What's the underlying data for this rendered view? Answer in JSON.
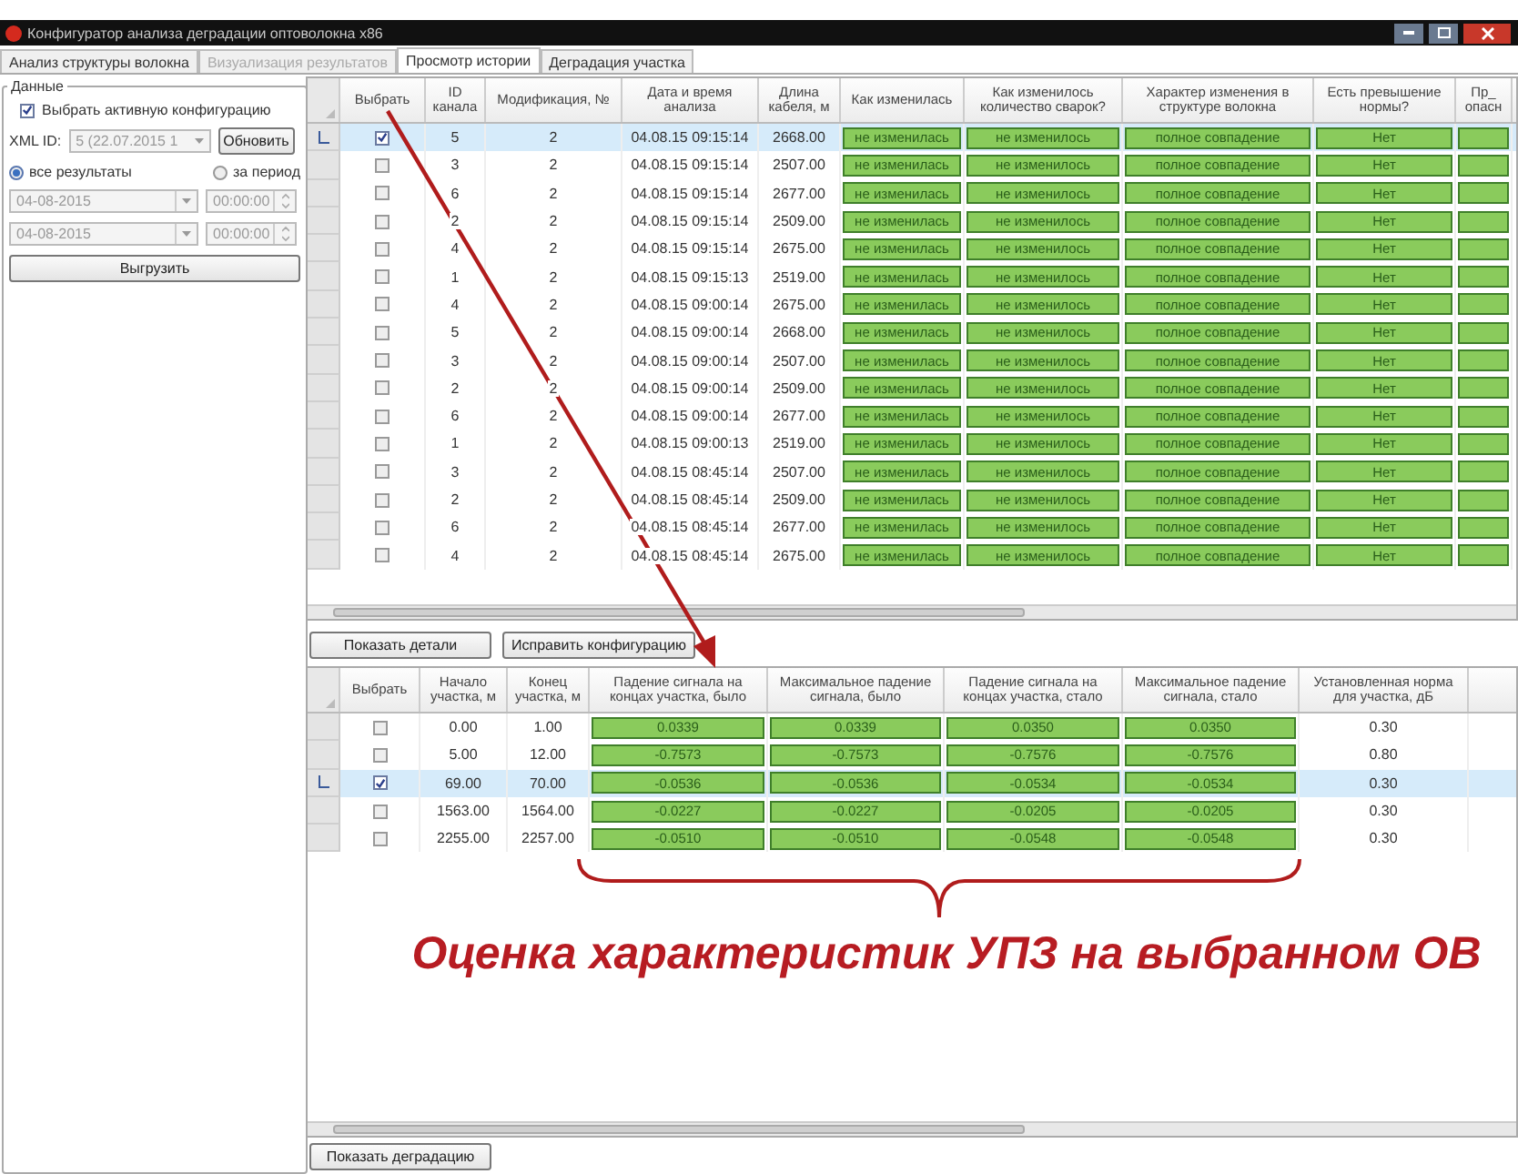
{
  "window": {
    "title": "Конфигуратор анализа деградации оптоволокна x86"
  },
  "tabs": [
    {
      "label": "Анализ структуры волокна",
      "selected": false,
      "disabled": false
    },
    {
      "label": "Визуализация результатов",
      "selected": false,
      "disabled": true
    },
    {
      "label": "Просмотр истории",
      "selected": true,
      "disabled": false
    },
    {
      "label": "Деградация участка",
      "selected": false,
      "disabled": false
    }
  ],
  "data_panel": {
    "title": "Данные",
    "active_config": {
      "label": "Выбрать активную конфигурацию",
      "checked": true
    },
    "xml_id": {
      "label": "XML ID:",
      "value": "5 (22.07.2015 1",
      "disabled": true
    },
    "refresh_button": "Обновить",
    "range_options": [
      {
        "label": "все результаты",
        "selected": true
      },
      {
        "label": "за период",
        "selected": false
      }
    ],
    "date_filters": [
      {
        "date": "04-08-2015",
        "time": "00:00:00",
        "disabled": true
      },
      {
        "date": "04-08-2015",
        "time": "00:00:00",
        "disabled": true
      }
    ],
    "export_button": "Выгрузить"
  },
  "history_table": {
    "check_column": "Выбрать",
    "columns": [
      {
        "label": "ID канала",
        "kind": "text"
      },
      {
        "label": "Модификация, №",
        "kind": "text"
      },
      {
        "label": "Дата и время анализа",
        "kind": "text"
      },
      {
        "label": "Длина кабеля, м",
        "kind": "text"
      },
      {
        "label": "Как изменилась",
        "kind": "status"
      },
      {
        "label": "Как изменилось количество сварок?",
        "kind": "status"
      },
      {
        "label": "Характер изменения в структуре волокна",
        "kind": "status"
      },
      {
        "label": "Есть превышение нормы?",
        "kind": "status"
      },
      {
        "label": "Пр_ опасн",
        "kind": "status"
      }
    ],
    "rows": [
      {
        "current": true,
        "checked": true,
        "cells": [
          "5",
          "2",
          "04.08.15 09:15:14",
          "2668.00",
          "не изменилась",
          "не изменилось",
          "полное совпадение",
          "Нет"
        ]
      },
      {
        "current": false,
        "checked": false,
        "cells": [
          "3",
          "2",
          "04.08.15 09:15:14",
          "2507.00",
          "не изменилась",
          "не изменилось",
          "полное совпадение",
          "Нет"
        ]
      },
      {
        "current": false,
        "checked": false,
        "cells": [
          "6",
          "2",
          "04.08.15 09:15:14",
          "2677.00",
          "не изменилась",
          "не изменилось",
          "полное совпадение",
          "Нет"
        ]
      },
      {
        "current": false,
        "checked": false,
        "cells": [
          "2",
          "2",
          "04.08.15 09:15:14",
          "2509.00",
          "не изменилась",
          "не изменилось",
          "полное совпадение",
          "Нет"
        ]
      },
      {
        "current": false,
        "checked": false,
        "cells": [
          "4",
          "2",
          "04.08.15 09:15:14",
          "2675.00",
          "не изменилась",
          "не изменилось",
          "полное совпадение",
          "Нет"
        ]
      },
      {
        "current": false,
        "checked": false,
        "cells": [
          "1",
          "2",
          "04.08.15 09:15:13",
          "2519.00",
          "не изменилась",
          "не изменилось",
          "полное совпадение",
          "Нет"
        ]
      },
      {
        "current": false,
        "checked": false,
        "cells": [
          "4",
          "2",
          "04.08.15 09:00:14",
          "2675.00",
          "не изменилась",
          "не изменилось",
          "полное совпадение",
          "Нет"
        ]
      },
      {
        "current": false,
        "checked": false,
        "cells": [
          "5",
          "2",
          "04.08.15 09:00:14",
          "2668.00",
          "не изменилась",
          "не изменилось",
          "полное совпадение",
          "Нет"
        ]
      },
      {
        "current": false,
        "checked": false,
        "cells": [
          "3",
          "2",
          "04.08.15 09:00:14",
          "2507.00",
          "не изменилась",
          "не изменилось",
          "полное совпадение",
          "Нет"
        ]
      },
      {
        "current": false,
        "checked": false,
        "cells": [
          "2",
          "2",
          "04.08.15 09:00:14",
          "2509.00",
          "не изменилась",
          "не изменилось",
          "полное совпадение",
          "Нет"
        ]
      },
      {
        "current": false,
        "checked": false,
        "cells": [
          "6",
          "2",
          "04.08.15 09:00:14",
          "2677.00",
          "не изменилась",
          "не изменилось",
          "полное совпадение",
          "Нет"
        ]
      },
      {
        "current": false,
        "checked": false,
        "cells": [
          "1",
          "2",
          "04.08.15 09:00:13",
          "2519.00",
          "не изменилась",
          "не изменилось",
          "полное совпадение",
          "Нет"
        ]
      },
      {
        "current": false,
        "checked": false,
        "cells": [
          "3",
          "2",
          "04.08.15 08:45:14",
          "2507.00",
          "не изменилась",
          "не изменилось",
          "полное совпадение",
          "Нет"
        ]
      },
      {
        "current": false,
        "checked": false,
        "cells": [
          "2",
          "2",
          "04.08.15 08:45:14",
          "2509.00",
          "не изменилась",
          "не изменилось",
          "полное совпадение",
          "Нет"
        ]
      },
      {
        "current": false,
        "checked": false,
        "cells": [
          "6",
          "2",
          "04.08.15 08:45:14",
          "2677.00",
          "не изменилась",
          "не изменилось",
          "полное совпадение",
          "Нет"
        ]
      },
      {
        "current": false,
        "checked": false,
        "cells": [
          "4",
          "2",
          "04.08.15 08:45:14",
          "2675.00",
          "не изменилась",
          "не изменилось",
          "полное совпадение",
          "Нет"
        ]
      }
    ]
  },
  "detail_buttons": [
    "Показать детали",
    "Исправить конфигурацию"
  ],
  "segment_table": {
    "check_column": "Выбрать",
    "columns": [
      {
        "label": "Начало участка, м",
        "kind": "text"
      },
      {
        "label": "Конец участка, м",
        "kind": "text"
      },
      {
        "label": "Падение сигнала на концах участка, было",
        "kind": "status"
      },
      {
        "label": "Максимальное падение сигнала, было",
        "kind": "status"
      },
      {
        "label": "Падение сигнала на концах участка, стало",
        "kind": "status"
      },
      {
        "label": "Максимальное падение сигнала, стало",
        "kind": "status"
      },
      {
        "label": "Установленная норма для участка, дБ",
        "kind": "text"
      }
    ],
    "rows": [
      {
        "current": false,
        "checked": false,
        "cells": [
          "0.00",
          "1.00",
          "0.0339",
          "0.0339",
          "0.0350",
          "0.0350",
          "0.30"
        ]
      },
      {
        "current": false,
        "checked": false,
        "cells": [
          "5.00",
          "12.00",
          "-0.7573",
          "-0.7573",
          "-0.7576",
          "-0.7576",
          "0.80"
        ]
      },
      {
        "current": true,
        "checked": true,
        "cells": [
          "69.00",
          "70.00",
          "-0.0536",
          "-0.0536",
          "-0.0534",
          "-0.0534",
          "0.30"
        ]
      },
      {
        "current": false,
        "checked": false,
        "cells": [
          "1563.00",
          "1564.00",
          "-0.0227",
          "-0.0227",
          "-0.0205",
          "-0.0205",
          "0.30"
        ]
      },
      {
        "current": false,
        "checked": false,
        "cells": [
          "2255.00",
          "2257.00",
          "-0.0510",
          "-0.0510",
          "-0.0548",
          "-0.0548",
          "0.30"
        ]
      }
    ]
  },
  "annotation": {
    "text": "Оценка характеристик УПЗ на выбранном ОВ"
  },
  "degradation_button": "Показать деградацию"
}
